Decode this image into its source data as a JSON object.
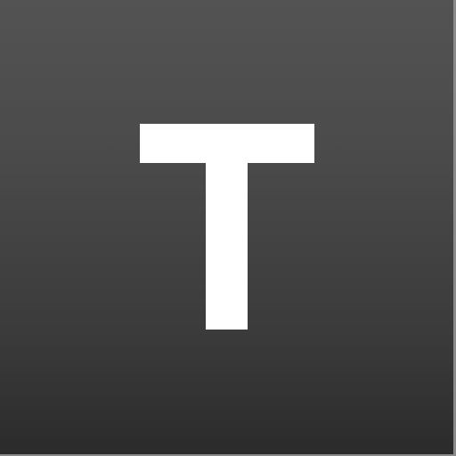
{
  "app_icon": {
    "glyph_icon": "letter-t-icon",
    "letter": "T",
    "colors": {
      "background_top": "#535353",
      "background_bottom": "#2b2b2b",
      "glyph": "#ffffff",
      "edge": "#8a8a8a"
    }
  }
}
